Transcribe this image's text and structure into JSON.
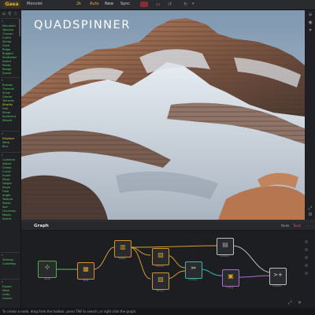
{
  "app": {
    "logo_label": "Gaea",
    "project_name": "Monolet"
  },
  "topbar": {
    "items": [
      {
        "label": "2k",
        "color": "#e8b22c"
      },
      {
        "label": "Auto",
        "color": "#e8b22c"
      },
      {
        "label": "New",
        "color": "#d8dade"
      },
      {
        "label": "Sync",
        "color": "#d8dade"
      }
    ],
    "status_color": "#8a2a33"
  },
  "viewport": {
    "brand_text": "QUADSPINNER"
  },
  "sidebar": {
    "groups": [
      {
        "items": [
          {
            "label": "Mountain",
            "color": "#5fcf6a"
          },
          {
            "label": "Volcano",
            "color": "#5fcf6a"
          },
          {
            "label": "Canyon",
            "color": "#5fcf6a"
          },
          {
            "label": "Crater",
            "color": "#5fcf6a"
          },
          {
            "label": "Slump",
            "color": "#5fcf6a"
          },
          {
            "label": "Cone",
            "color": "#5fcf6a"
          },
          {
            "label": "Ridge",
            "color": "#5fcf6a"
          },
          {
            "label": "Rugged",
            "color": "#5fcf6a"
          },
          {
            "label": "Shattered",
            "color": "#5fcf6a"
          },
          {
            "label": "Island",
            "color": "#5fcf6a"
          },
          {
            "label": "Peaks",
            "color": "#5fcf6a"
          },
          {
            "label": "Range",
            "color": "#5fcf6a"
          },
          {
            "label": "Dunes",
            "color": "#5fcf6a"
          }
        ]
      },
      {
        "items": [
          {
            "label": "Erosion",
            "color": "#5fcf6a"
          },
          {
            "label": "Thermal",
            "color": "#5fcf6a"
          },
          {
            "label": "Snow",
            "color": "#5fcf6a"
          },
          {
            "label": "Glacier",
            "color": "#5fcf6a"
          },
          {
            "label": "Terraces",
            "color": "#5fcf6a"
          },
          {
            "label": "Stratify",
            "color": "#e8d22c"
          },
          {
            "label": "Fold",
            "color": "#5fcf6a"
          },
          {
            "label": "Shear",
            "color": "#5fcf6a"
          },
          {
            "label": "Sediment",
            "color": "#5fcf6a"
          },
          {
            "label": "Wizard",
            "color": "#5fcf6a"
          }
        ]
      },
      {
        "items": [
          {
            "label": "Displace",
            "color": "#e8d22c"
          },
          {
            "label": "Warp",
            "color": "#5fcf6a"
          },
          {
            "label": "Blur",
            "color": "#5fcf6a"
          }
        ]
      },
      {
        "items": [
          {
            "label": "Combine",
            "color": "#5fcf6a"
          },
          {
            "label": "Adjust",
            "color": "#5fcf6a"
          },
          {
            "label": "Clamp",
            "color": "#5fcf6a"
          },
          {
            "label": "Curve",
            "color": "#5fcf6a"
          },
          {
            "label": "Invert",
            "color": "#5fcf6a"
          },
          {
            "label": "Mixer",
            "color": "#5fcf6a"
          },
          {
            "label": "Height",
            "color": "#5fcf6a"
          },
          {
            "label": "Slope",
            "color": "#5fcf6a"
          },
          {
            "label": "Flow",
            "color": "#5fcf6a"
          },
          {
            "label": "Angle",
            "color": "#5fcf6a"
          },
          {
            "label": "Texture",
            "color": "#5fcf6a"
          },
          {
            "label": "Peaks",
            "color": "#5fcf6a"
          },
          {
            "label": "Soil",
            "color": "#5fcf6a"
          },
          {
            "label": "Occlusion",
            "color": "#5fcf6a"
          },
          {
            "label": "Masks",
            "color": "#5fcf6a"
          },
          {
            "label": "Select",
            "color": "#5fcf6a"
          }
        ]
      },
      {
        "items": [
          {
            "label": "Satmap",
            "color": "#5fcf6a"
          },
          {
            "label": "ColorMap",
            "color": "#5fcf6a"
          }
        ]
      },
      {
        "items": [
          {
            "label": "Export",
            "color": "#5fcf6a"
          },
          {
            "label": "Mesh",
            "color": "#5fcf6a"
          },
          {
            "label": "Unity",
            "color": "#5fcf6a"
          },
          {
            "label": "Unreal",
            "color": "#5fcf6a"
          }
        ]
      }
    ]
  },
  "graph": {
    "title": "Graph",
    "options": [
      {
        "label": "Node",
        "color": "#9aa0a6"
      },
      {
        "label": "Tools",
        "color": "#d64f9a"
      }
    ],
    "nodes": [
      {
        "label": "Seeds",
        "icon": "✣",
        "border": "#4fb04a"
      },
      {
        "label": "Node",
        "icon": "▦",
        "border": "#d7912c"
      },
      {
        "label": "Stratify",
        "icon": "▥",
        "border": "#d7912c"
      },
      {
        "label": "Thermal",
        "icon": "▨",
        "border": "#d7912c"
      },
      {
        "label": "Terrace",
        "icon": "▨",
        "border": "#d7912c"
      },
      {
        "label": "Combine",
        "icon": "✂",
        "border": "#3fb4a6"
      },
      {
        "label": "Combine",
        "icon": "▤",
        "border": "#bfbfbf"
      },
      {
        "label": "Lookup",
        "icon": "▣",
        "border": "#b06bd0"
      },
      {
        "label": "Combine",
        "icon": ">+",
        "border": "#bfbfbf"
      }
    ]
  },
  "statusbar": {
    "hint": "To create a node, drag from the toolbar, press TAB to search, or right click the graph."
  }
}
